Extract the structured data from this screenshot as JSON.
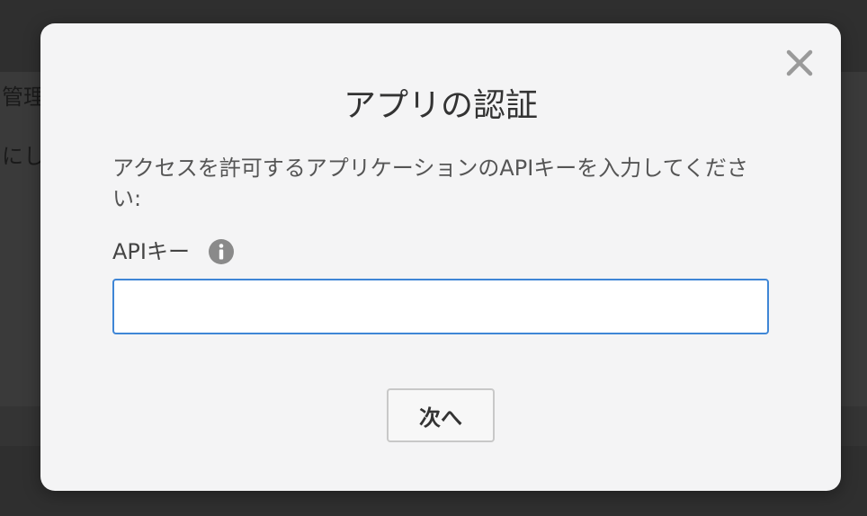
{
  "background": {
    "text_line_1": "管理",
    "text_line_2": "にし"
  },
  "modal": {
    "title": "アプリの認証",
    "description": "アクセスを許可するアプリケーションのAPIキーを入力してください:",
    "field_label": "APIキー",
    "input_value": "",
    "input_placeholder": "",
    "next_button_label": "次へ",
    "icons": {
      "close": "close-icon",
      "info": "info-icon"
    },
    "colors": {
      "input_border": "#3f86d6",
      "modal_bg": "#f4f4f5",
      "overlay": "#2f2f2f"
    }
  }
}
